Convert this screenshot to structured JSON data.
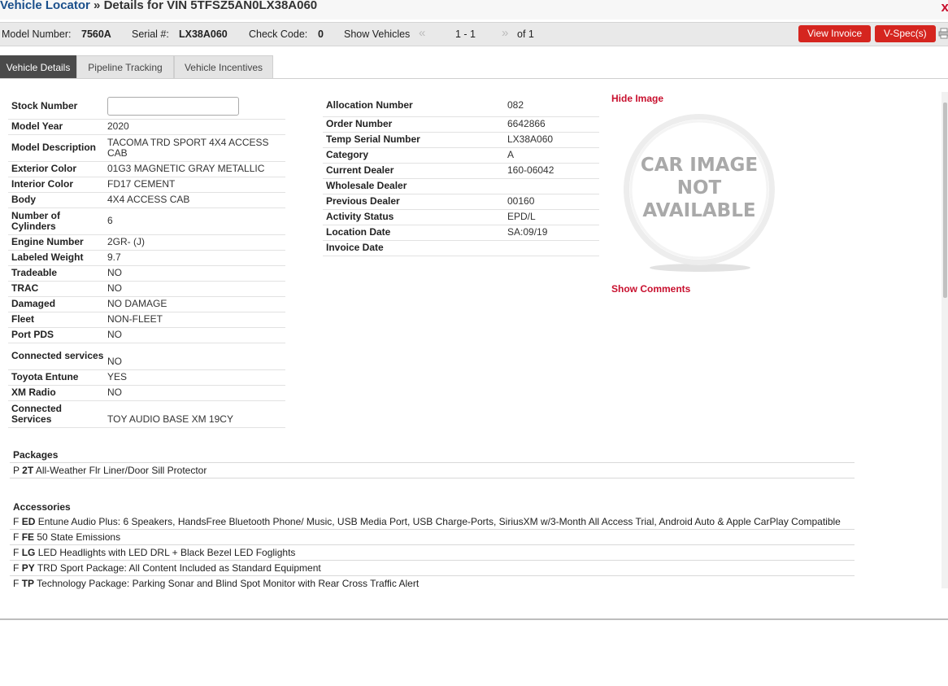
{
  "header": {
    "app_title": "Vehicle Locator",
    "separator": " » ",
    "details_title": "Details for VIN 5TFSZ5AN0LX38A060",
    "close_glyph": "x"
  },
  "infobar": {
    "model_number_label": "Model Number:",
    "model_number_value": "7560A",
    "serial_label": "Serial #:",
    "serial_value": "LX38A060",
    "check_code_label": "Check Code:",
    "check_code_value": "0",
    "show_vehicles_label": "Show Vehicles",
    "prev_glyph": "«",
    "range_text": "1 - 1",
    "next_glyph": "»",
    "of_text": "of 1",
    "view_invoice_label": "View Invoice",
    "vspec_label": "V-Spec(s)"
  },
  "tabs": [
    "Vehicle Details",
    "Pipeline Tracking",
    "Vehicle Incentives"
  ],
  "left_details": [
    {
      "label": "Stock Number",
      "value": ""
    },
    {
      "label": "Model Year",
      "value": "2020"
    },
    {
      "label": "Model Description",
      "value": "TACOMA TRD SPORT 4X4 ACCESS CAB"
    },
    {
      "label": "Exterior Color",
      "value": "01G3 MAGNETIC GRAY METALLIC"
    },
    {
      "label": "Interior Color",
      "value": "FD17 CEMENT"
    },
    {
      "label": "Body",
      "value": "4X4 ACCESS CAB"
    },
    {
      "label": "Number of Cylinders",
      "value": "6"
    },
    {
      "label": "Engine Number",
      "value": "2GR- (J)"
    },
    {
      "label": "Labeled Weight",
      "value": "9.7"
    },
    {
      "label": "Tradeable",
      "value": "NO"
    },
    {
      "label": "TRAC",
      "value": "NO"
    },
    {
      "label": "Damaged",
      "value": "NO DAMAGE"
    },
    {
      "label": "Fleet",
      "value": "NON-FLEET"
    },
    {
      "label": "Port PDS",
      "value": "NO"
    },
    {
      "label": "Connected services",
      "value": "NO"
    },
    {
      "label": "Toyota Entune",
      "value": "YES"
    },
    {
      "label": "XM Radio",
      "value": "NO"
    },
    {
      "label": "Connected Services",
      "value": "TOY AUDIO BASE XM 19CY"
    }
  ],
  "right_details": [
    {
      "label": "Allocation Number",
      "value": "082"
    },
    {
      "label": "Order Number",
      "value": "6642866"
    },
    {
      "label": "Temp Serial Number",
      "value": "LX38A060"
    },
    {
      "label": "Category",
      "value": "A"
    },
    {
      "label": "Current Dealer",
      "value": "160-06042"
    },
    {
      "label": "Wholesale Dealer",
      "value": ""
    },
    {
      "label": "Previous Dealer",
      "value": "00160"
    },
    {
      "label": "Activity Status",
      "value": "EPD/L"
    },
    {
      "label": "Location Date",
      "value": "SA:09/19"
    },
    {
      "label": "Invoice Date",
      "value": ""
    }
  ],
  "image_panel": {
    "hide_image_label": "Hide Image",
    "placeholder_lines": [
      "CAR IMAGE",
      "NOT",
      "AVAILABLE"
    ],
    "show_comments_label": "Show Comments"
  },
  "packages": {
    "title": "Packages",
    "items": [
      {
        "prefix": "P",
        "code": "2T",
        "text": "All-Weather Flr Liner/Door Sill Protector"
      }
    ]
  },
  "accessories": {
    "title": "Accessories",
    "items": [
      {
        "prefix": "F",
        "code": "ED",
        "text": "Entune Audio Plus: 6 Speakers, HandsFree Bluetooth Phone/ Music, USB Media Port, USB Charge-Ports, SiriusXM w/3-Month All Access Trial, Android Auto & Apple CarPlay Compatible"
      },
      {
        "prefix": "F",
        "code": "FE",
        "text": "50 State Emissions"
      },
      {
        "prefix": "F",
        "code": "LG",
        "text": "LED Headlights with LED DRL + Black Bezel LED Foglights"
      },
      {
        "prefix": "F",
        "code": "PY",
        "text": "TRD Sport Package: All Content Included as Standard Equipment"
      },
      {
        "prefix": "F",
        "code": "TP",
        "text": "Technology Package: Parking Sonar and Blind Spot Monitor with Rear Cross Traffic Alert"
      }
    ]
  }
}
